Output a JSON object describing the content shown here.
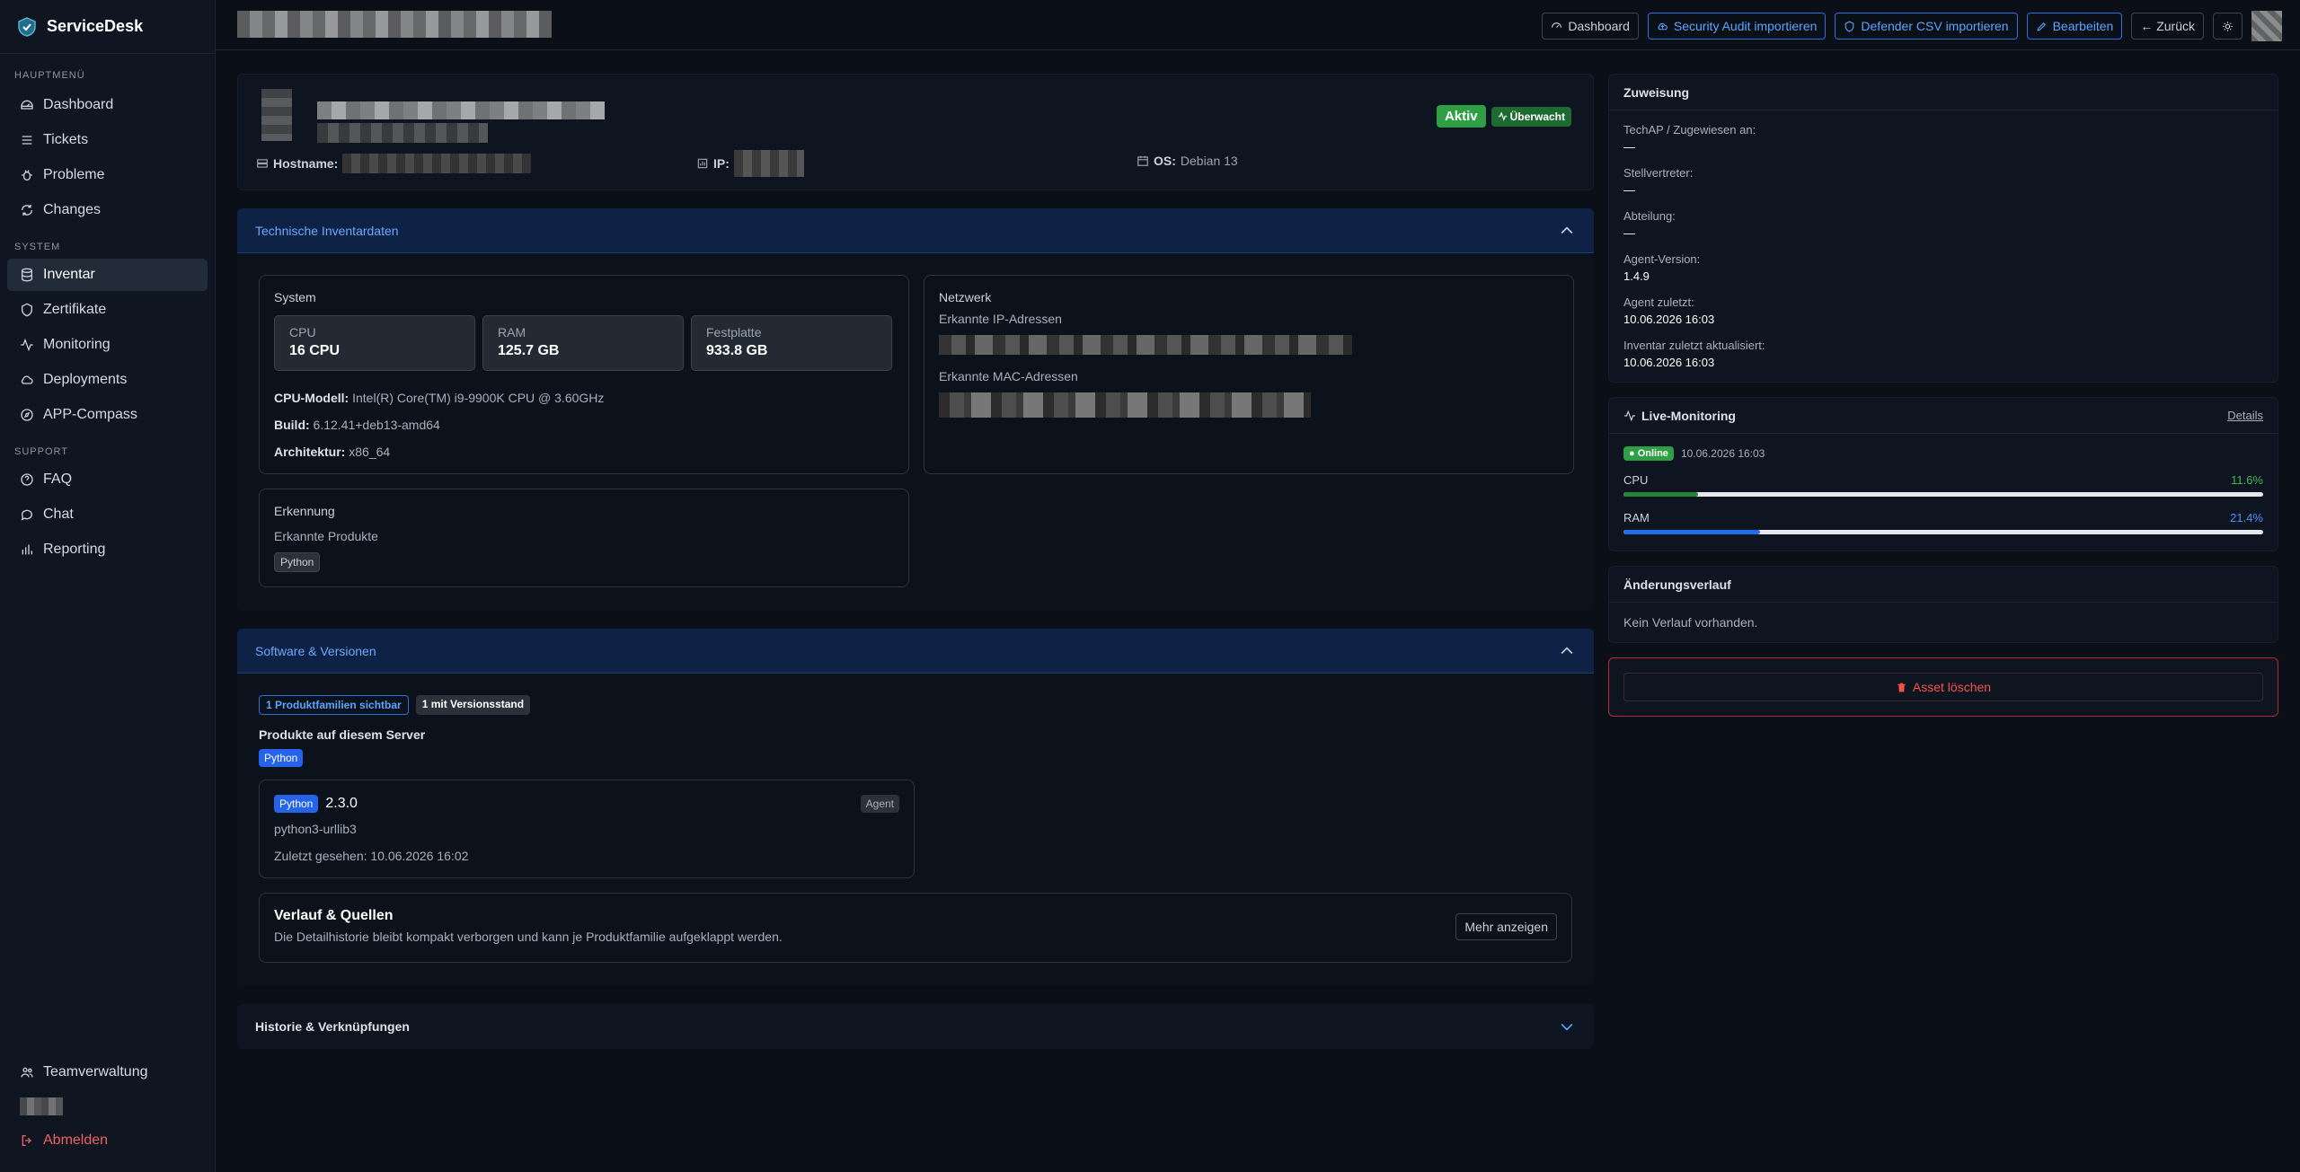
{
  "app": {
    "name": "ServiceDesk"
  },
  "sidebar": {
    "sections": [
      {
        "title": "HAUPTMENÜ",
        "items": [
          {
            "label": "Dashboard",
            "icon": "dashboard-icon"
          },
          {
            "label": "Tickets",
            "icon": "tickets-icon"
          },
          {
            "label": "Probleme",
            "icon": "bug-icon"
          },
          {
            "label": "Changes",
            "icon": "refresh-icon"
          }
        ]
      },
      {
        "title": "SYSTEM",
        "items": [
          {
            "label": "Inventar",
            "icon": "database-icon",
            "active": true
          },
          {
            "label": "Zertifikate",
            "icon": "shield-icon"
          },
          {
            "label": "Monitoring",
            "icon": "activity-icon"
          },
          {
            "label": "Deployments",
            "icon": "cloud-icon"
          },
          {
            "label": "APP-Compass",
            "icon": "compass-icon"
          }
        ]
      },
      {
        "title": "SUPPORT",
        "items": [
          {
            "label": "FAQ",
            "icon": "help-icon"
          },
          {
            "label": "Chat",
            "icon": "chat-icon"
          },
          {
            "label": "Reporting",
            "icon": "chart-icon"
          }
        ]
      }
    ],
    "bottom": {
      "team": "Teamverwaltung",
      "logout": "Abmelden"
    }
  },
  "toolbar": {
    "dashboard": "Dashboard",
    "security_audit": "Security Audit importieren",
    "defender_csv": "Defender CSV importieren",
    "edit": "Bearbeiten",
    "back": "← Zurück"
  },
  "asset": {
    "status": "Aktiv",
    "monitor_badge": "Überwacht",
    "hostname_label": "Hostname:",
    "ip_label": "IP:",
    "os_label": "OS:",
    "os_value": "Debian 13"
  },
  "inventory": {
    "section_title": "Technische Inventardaten",
    "system_title": "System",
    "stats": [
      {
        "label": "CPU",
        "value": "16 CPU"
      },
      {
        "label": "RAM",
        "value": "125.7 GB"
      },
      {
        "label": "Festplatte",
        "value": "933.8 GB"
      }
    ],
    "cpu_model_label": "CPU-Modell:",
    "cpu_model": "Intel(R) Core(TM) i9-9900K CPU @ 3.60GHz",
    "build_label": "Build:",
    "build": "6.12.41+deb13-amd64",
    "arch_label": "Architektur:",
    "arch": "x86_64",
    "network_title": "Netzwerk",
    "ip_list_label": "Erkannte IP-Adressen",
    "mac_list_label": "Erkannte MAC-Adressen",
    "detection_title": "Erkennung",
    "products_label": "Erkannte Produkte",
    "products_tag": "Python"
  },
  "software": {
    "section_title": "Software & Versionen",
    "chip_visible": "1 Produktfamilien sichtbar",
    "chip_version": "1 mit Versionsstand",
    "products_title": "Produkte auf diesem Server",
    "product_tag": "Python",
    "card": {
      "tag": "Python",
      "version": "2.3.0",
      "source": "Agent",
      "package": "python3-urllib3",
      "seen": "Zuletzt gesehen: 10.06.2026 16:02"
    },
    "history": {
      "title": "Verlauf & Quellen",
      "desc": "Die Detailhistorie bleibt kompakt verborgen und kann je Produktfamilie aufgeklappt werden.",
      "button": "Mehr anzeigen"
    }
  },
  "historie": {
    "title": "Historie & Verknüpfungen"
  },
  "assignment": {
    "title": "Zuweisung",
    "fields": [
      {
        "label": "TechAP / Zugewiesen an:",
        "value": "—"
      },
      {
        "label": "Stellvertreter:",
        "value": "—"
      },
      {
        "label": "Abteilung:",
        "value": "—"
      },
      {
        "label": "Agent-Version:",
        "value": "1.4.9"
      },
      {
        "label": "Agent zuletzt:",
        "value": "10.06.2026 16:03"
      },
      {
        "label": "Inventar zuletzt aktualisiert:",
        "value": "10.06.2026 16:03"
      }
    ]
  },
  "live": {
    "title": "Live-Monitoring",
    "details": "Details",
    "status": "● Online",
    "time": "10.06.2026 16:03",
    "cpu_label": "CPU",
    "cpu_pct": "11.6%",
    "cpu_value": 11.6,
    "ram_label": "RAM",
    "ram_pct": "21.4%",
    "ram_value": 21.4,
    "colors": {
      "cpu": "#238636",
      "ram": "#1f6feb"
    }
  },
  "changes": {
    "title": "Änderungsverlauf",
    "empty": "Kein Verlauf vorhanden."
  },
  "danger": {
    "delete": "Asset löschen"
  }
}
